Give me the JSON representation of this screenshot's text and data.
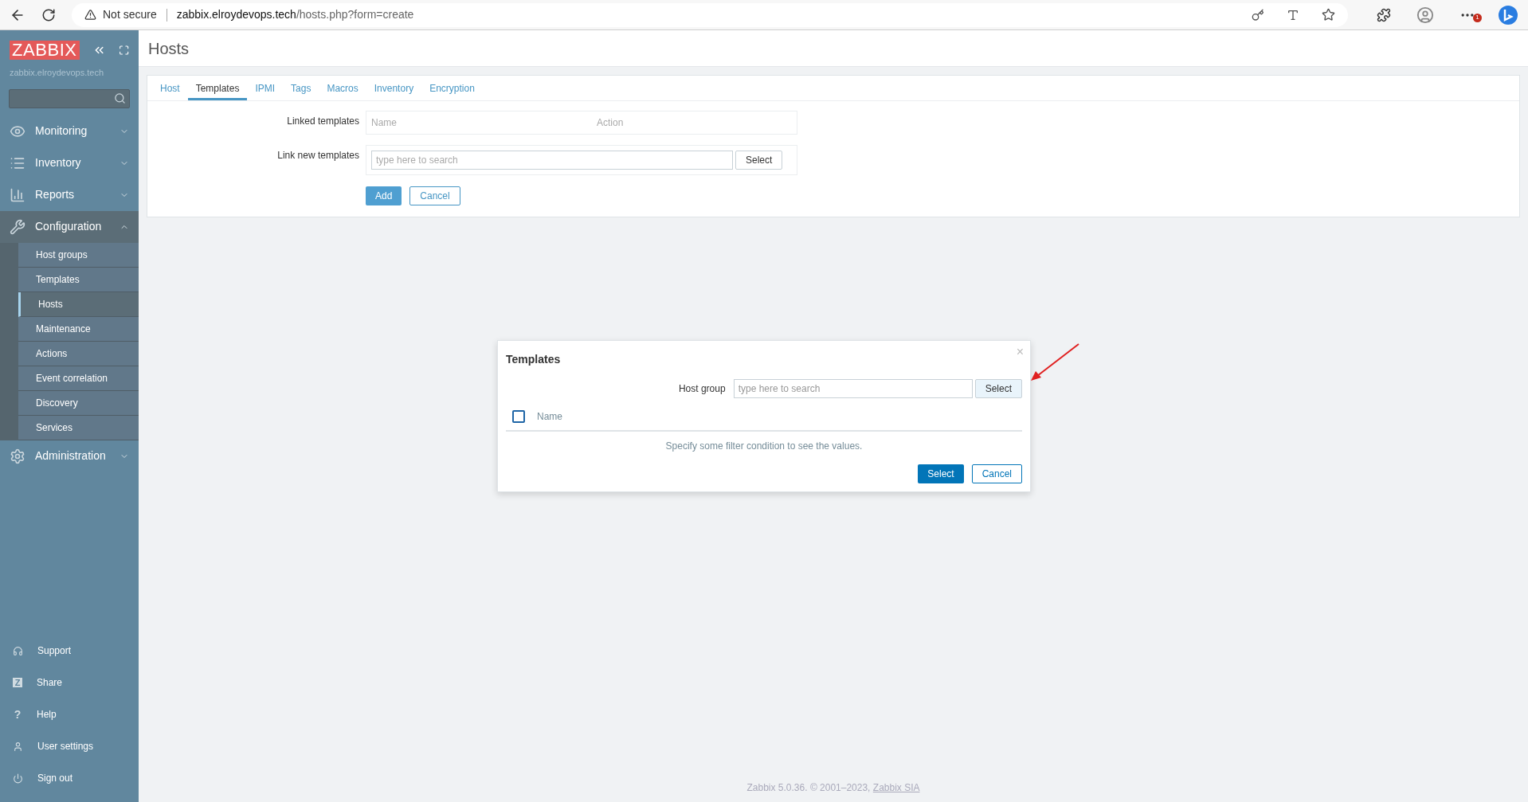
{
  "browser": {
    "security": "Not secure",
    "url_host": "zabbix.elroydevops.tech",
    "url_path": "/hosts.php?form=create",
    "badge": "1"
  },
  "sidebar": {
    "logo": "ZABBIX",
    "server": "zabbix.elroydevops.tech",
    "menu": [
      {
        "label": "Monitoring",
        "expanded": false
      },
      {
        "label": "Inventory",
        "expanded": false
      },
      {
        "label": "Reports",
        "expanded": false
      },
      {
        "label": "Configuration",
        "expanded": true,
        "children": [
          {
            "label": "Host groups",
            "selected": false
          },
          {
            "label": "Templates",
            "selected": false
          },
          {
            "label": "Hosts",
            "selected": true
          },
          {
            "label": "Maintenance",
            "selected": false
          },
          {
            "label": "Actions",
            "selected": false
          },
          {
            "label": "Event correlation",
            "selected": false
          },
          {
            "label": "Discovery",
            "selected": false
          },
          {
            "label": "Services",
            "selected": false
          }
        ]
      },
      {
        "label": "Administration",
        "expanded": false
      }
    ],
    "footer": [
      {
        "label": "Support"
      },
      {
        "label": "Share",
        "icon_text": "Z"
      },
      {
        "label": "Help",
        "icon_text": "?"
      },
      {
        "label": "User settings"
      },
      {
        "label": "Sign out"
      }
    ]
  },
  "page": {
    "title": "Hosts",
    "tabs": [
      {
        "label": "Host",
        "selected": false
      },
      {
        "label": "Templates",
        "selected": true
      },
      {
        "label": "IPMI",
        "selected": false
      },
      {
        "label": "Tags",
        "selected": false
      },
      {
        "label": "Macros",
        "selected": false
      },
      {
        "label": "Inventory",
        "selected": false
      },
      {
        "label": "Encryption",
        "selected": false
      }
    ],
    "linked_label": "Linked templates",
    "linked_columns": [
      "Name",
      "Action"
    ],
    "link_new_label": "Link new templates",
    "link_new_placeholder": "type here to search",
    "link_new_button": "Select",
    "buttons": [
      "Add",
      "Cancel"
    ]
  },
  "dialog": {
    "title": "Templates",
    "close": "×",
    "filter_label": "Host group",
    "filter_placeholder": "type here to search",
    "filter_button": "Select",
    "select_all_checked": false,
    "column": "Name",
    "message": "Specify some filter condition to see the values.",
    "buttons": [
      "Select",
      "Cancel"
    ]
  },
  "footer": {
    "text": "Zabbix 5.0.36. © 2001–2023, ",
    "link": "Zabbix SIA"
  }
}
